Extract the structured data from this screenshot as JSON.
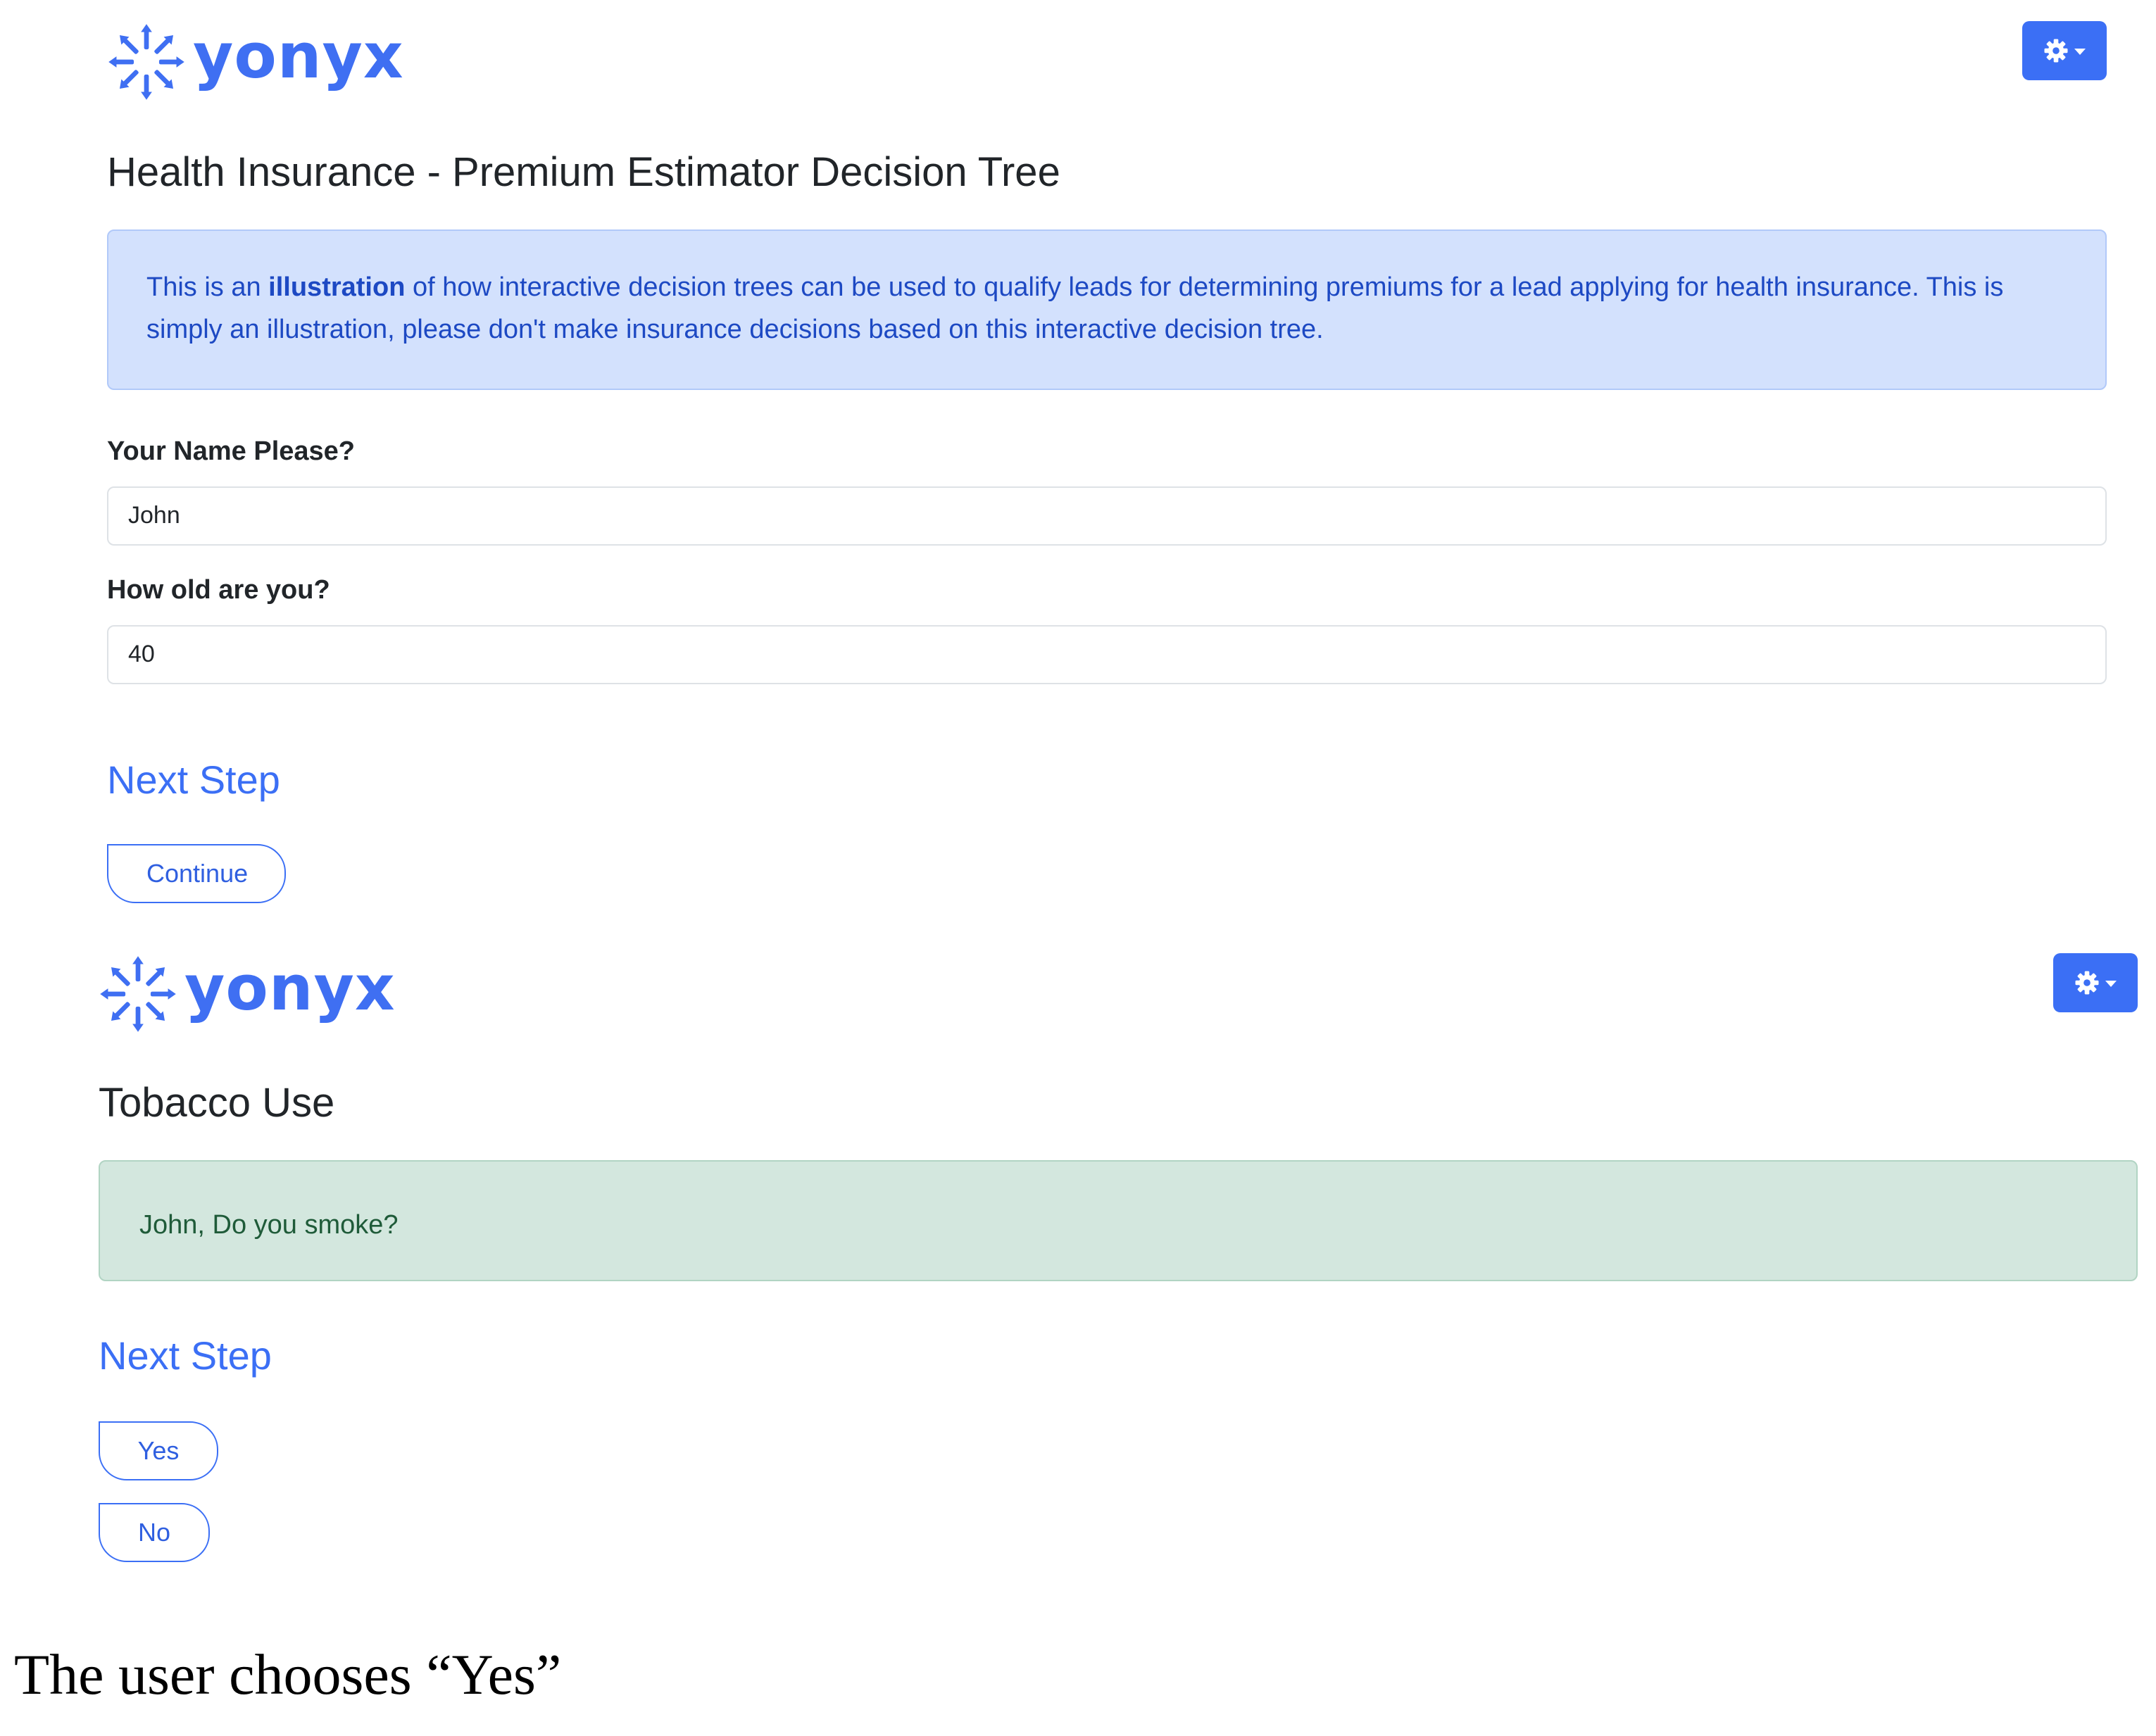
{
  "brand": {
    "name": "yonyx",
    "color": "#3f6ff2"
  },
  "settings_button": {
    "icon": "gear-icon",
    "color": "#3b6ff5"
  },
  "step1": {
    "title": "Health Insurance - Premium Estimator Decision Tree",
    "info": {
      "prefix": "This is an ",
      "emphasis": "illustration",
      "suffix": " of how interactive decision trees can be used to qualify leads for determining premiums for a lead applying for health insurance. This is simply an illustration, please don't make insurance decisions based on this interactive decision tree."
    },
    "name_field": {
      "label": "Your Name Please?",
      "value": "John"
    },
    "age_field": {
      "label": "How old are you?",
      "value": "40"
    },
    "next_step_heading": "Next Step",
    "continue_label": "Continue"
  },
  "step2": {
    "title": "Tobacco Use",
    "question": "John, Do you smoke?",
    "next_step_heading": "Next Step",
    "yes_label": "Yes",
    "no_label": "No"
  },
  "caption": "The user chooses “Yes”"
}
